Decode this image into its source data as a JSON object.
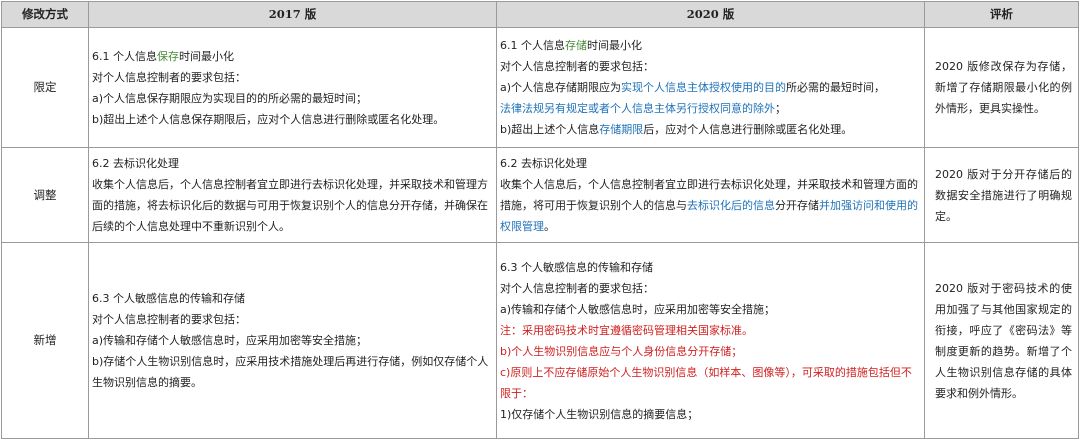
{
  "headers": {
    "col_type": "修改方式",
    "col_2017": "2017 版",
    "col_2020": "2020 版",
    "col_eval": "评析"
  },
  "rows": [
    {
      "type": "限定",
      "v2017": {
        "title_pre": "6.1 个人信息",
        "title_hl": "保存",
        "title_post": "时间最小化",
        "l1": "对个人信息控制者的要求包括：",
        "l2": "a)个人信息保存期限应为实现目的的所必需的最短时间；",
        "l3": "b)超出上述个人信息保存期限后，应对个人信息进行删除或匿名化处理。"
      },
      "v2020": {
        "title_pre": "6.1 个人信息",
        "title_hl": "存储",
        "title_post": "时间最小化",
        "l1": "对个人信息控制者的要求包括：",
        "l2_pre": "a)个人信息存储期限应为",
        "l2_hl": "实现个人信息主体授权使用的目的",
        "l2_post": "所必需的最短时间，",
        "l3_hl": "法律法规另有规定或者个人信息主体另行授权同意的除外",
        "l3_post": "；",
        "l4_pre": "b)超出上述个人信息",
        "l4_hl": "存储期限",
        "l4_post": "后，应对个人信息进行删除或匿名化处理。"
      },
      "eval": "2020 版修改保存为存储，新增了存储期限最小化的例外情形，更具实操性。"
    },
    {
      "type": "调整",
      "v2017": {
        "title": "6.2 去标识化处理",
        "body": "收集个人信息后，个人信息控制者宜立即进行去标识化处理，并采取技术和管理方面的措施，将去标识化后的数据与可用于恢复识别个人的信息分开存储，并确保在后续的个人信息处理中不重新识别个人。"
      },
      "v2020": {
        "title": "6.2 去标识化处理",
        "body_pre": "收集个人信息后，个人信息控制者宜立即进行去标识化处理，并采取技术和管理方面的措施，将可用于恢复识别个人的信息与",
        "body_hl1": "去标识化后的信息",
        "body_mid": "分开存储",
        "body_hl2": "并加强访问和使用的权限管理",
        "body_post": "。"
      },
      "eval": "2020 版对于分开存储后的数据安全措施进行了明确规定。"
    },
    {
      "type": "新增",
      "v2017": {
        "title": "6.3 个人敏感信息的传输和存储",
        "l1": "对个人信息控制者的要求包括：",
        "l2": "a)传输和存储个人敏感信息时，应采用加密等安全措施；",
        "l3": "b)存储个人生物识别信息时，应采用技术措施处理后再进行存储，例如仅存储个人生物识别信息的摘要。"
      },
      "v2020": {
        "title": "6.3 个人敏感信息的传输和存储",
        "l1": "对个人信息控制者的要求包括：",
        "l2": "a)传输和存储个人敏感信息时，应采用加密等安全措施；",
        "l3": "注：采用密码技术时宜遵循密码管理相关国家标准。",
        "l4": "b)个人生物识别信息应与个人身份信息分开存储；",
        "l5": "c)原则上不应存储原始个人生物识别信息（如样本、图像等），可采取的措施包括但不限于：",
        "l6": "1)仅存储个人生物识别信息的摘要信息；"
      },
      "eval": "2020 版对于密码技术的使用加强了与其他国家规定的衔接，呼应了《密码法》等制度更新的趋势。新增了个人生物识别信息存储的具体要求和例外情形。"
    }
  ]
}
